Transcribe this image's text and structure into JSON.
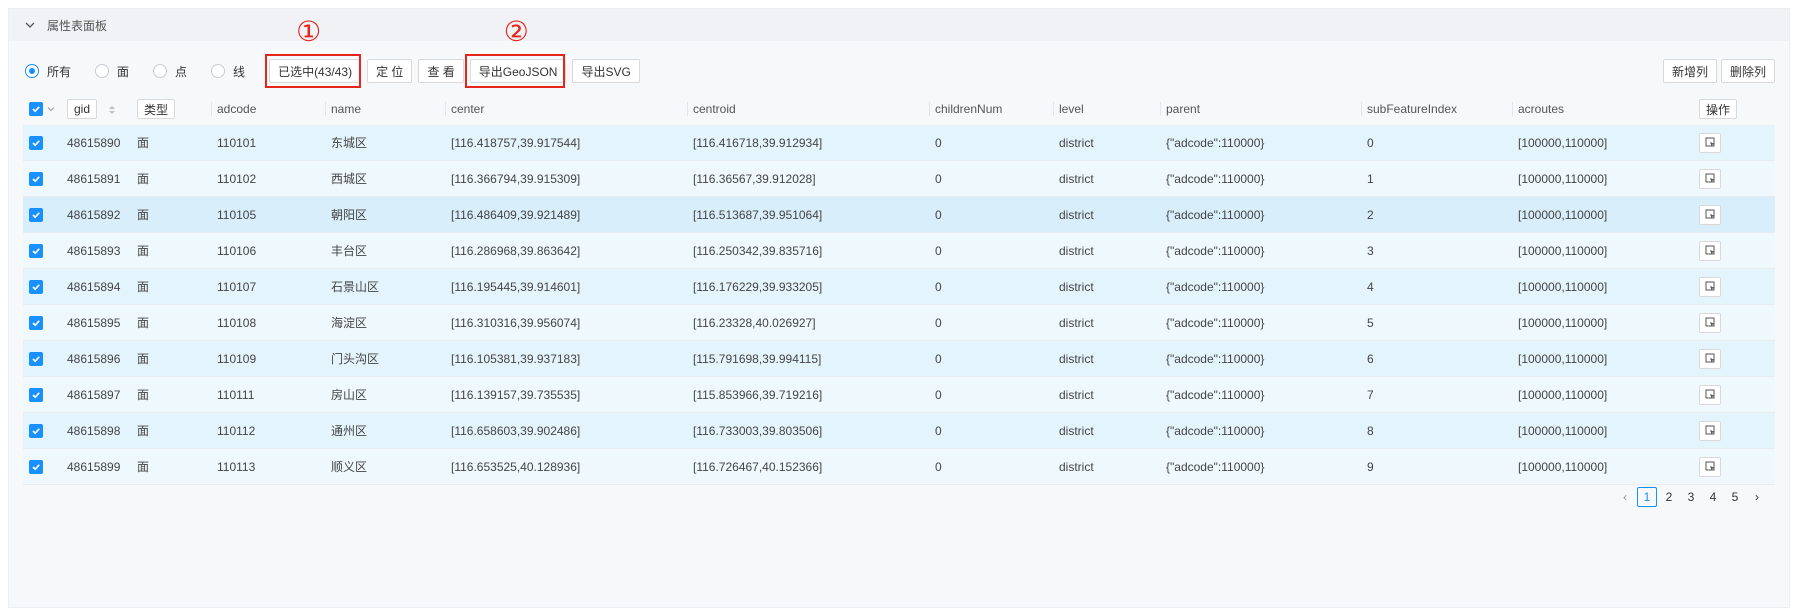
{
  "panel": {
    "title": "属性表面板"
  },
  "toolbar": {
    "radios": [
      {
        "label": "所有",
        "checked": true
      },
      {
        "label": "面",
        "checked": false
      },
      {
        "label": "点",
        "checked": false
      },
      {
        "label": "线",
        "checked": false
      }
    ],
    "selected_label": "已选中(43/43)",
    "locate_label": "定 位",
    "view_label": "查 看",
    "export_geojson_label": "导出GeoJSON",
    "export_svg_label": "导出SVG",
    "add_column_label": "新增列",
    "delete_column_label": "删除列",
    "annotation_1": "①",
    "annotation_2": "②",
    "annotation_color": "#e8251c"
  },
  "table": {
    "headers": {
      "gid": "gid",
      "type": "类型",
      "adcode": "adcode",
      "name": "name",
      "center": "center",
      "centroid": "centroid",
      "childrenNum": "childrenNum",
      "level": "level",
      "parent": "parent",
      "subFeatureIndex": "subFeatureIndex",
      "acroutes": "acroutes",
      "action": "操作"
    },
    "rows": [
      {
        "gid": "48615890",
        "type": "面",
        "adcode": "110101",
        "name": "东城区",
        "center": "[116.418757,39.917544]",
        "centroid": "[116.416718,39.912934]",
        "childrenNum": "0",
        "level": "district",
        "parent": "{\"adcode\":110000}",
        "subFeatureIndex": "0",
        "acroutes": "[100000,110000]"
      },
      {
        "gid": "48615891",
        "type": "面",
        "adcode": "110102",
        "name": "西城区",
        "center": "[116.366794,39.915309]",
        "centroid": "[116.36567,39.912028]",
        "childrenNum": "0",
        "level": "district",
        "parent": "{\"adcode\":110000}",
        "subFeatureIndex": "1",
        "acroutes": "[100000,110000]"
      },
      {
        "gid": "48615892",
        "type": "面",
        "adcode": "110105",
        "name": "朝阳区",
        "center": "[116.486409,39.921489]",
        "centroid": "[116.513687,39.951064]",
        "childrenNum": "0",
        "level": "district",
        "parent": "{\"adcode\":110000}",
        "subFeatureIndex": "2",
        "acroutes": "[100000,110000]"
      },
      {
        "gid": "48615893",
        "type": "面",
        "adcode": "110106",
        "name": "丰台区",
        "center": "[116.286968,39.863642]",
        "centroid": "[116.250342,39.835716]",
        "childrenNum": "0",
        "level": "district",
        "parent": "{\"adcode\":110000}",
        "subFeatureIndex": "3",
        "acroutes": "[100000,110000]"
      },
      {
        "gid": "48615894",
        "type": "面",
        "adcode": "110107",
        "name": "石景山区",
        "center": "[116.195445,39.914601]",
        "centroid": "[116.176229,39.933205]",
        "childrenNum": "0",
        "level": "district",
        "parent": "{\"adcode\":110000}",
        "subFeatureIndex": "4",
        "acroutes": "[100000,110000]"
      },
      {
        "gid": "48615895",
        "type": "面",
        "adcode": "110108",
        "name": "海淀区",
        "center": "[116.310316,39.956074]",
        "centroid": "[116.23328,40.026927]",
        "childrenNum": "0",
        "level": "district",
        "parent": "{\"adcode\":110000}",
        "subFeatureIndex": "5",
        "acroutes": "[100000,110000]"
      },
      {
        "gid": "48615896",
        "type": "面",
        "adcode": "110109",
        "name": "门头沟区",
        "center": "[116.105381,39.937183]",
        "centroid": "[115.791698,39.994115]",
        "childrenNum": "0",
        "level": "district",
        "parent": "{\"adcode\":110000}",
        "subFeatureIndex": "6",
        "acroutes": "[100000,110000]"
      },
      {
        "gid": "48615897",
        "type": "面",
        "adcode": "110111",
        "name": "房山区",
        "center": "[116.139157,39.735535]",
        "centroid": "[115.853966,39.719216]",
        "childrenNum": "0",
        "level": "district",
        "parent": "{\"adcode\":110000}",
        "subFeatureIndex": "7",
        "acroutes": "[100000,110000]"
      },
      {
        "gid": "48615898",
        "type": "面",
        "adcode": "110112",
        "name": "通州区",
        "center": "[116.658603,39.902486]",
        "centroid": "[116.733003,39.803506]",
        "childrenNum": "0",
        "level": "district",
        "parent": "{\"adcode\":110000}",
        "subFeatureIndex": "8",
        "acroutes": "[100000,110000]"
      },
      {
        "gid": "48615899",
        "type": "面",
        "adcode": "110113",
        "name": "顺义区",
        "center": "[116.653525,40.128936]",
        "centroid": "[116.726467,40.152366]",
        "childrenNum": "0",
        "level": "district",
        "parent": "{\"adcode\":110000}",
        "subFeatureIndex": "9",
        "acroutes": "[100000,110000]"
      }
    ]
  },
  "pagination": {
    "pages": [
      "1",
      "2",
      "3",
      "4",
      "5"
    ],
    "current": "1"
  },
  "colors": {
    "accent": "#1890ff",
    "row_bg": "#eef8fd"
  }
}
